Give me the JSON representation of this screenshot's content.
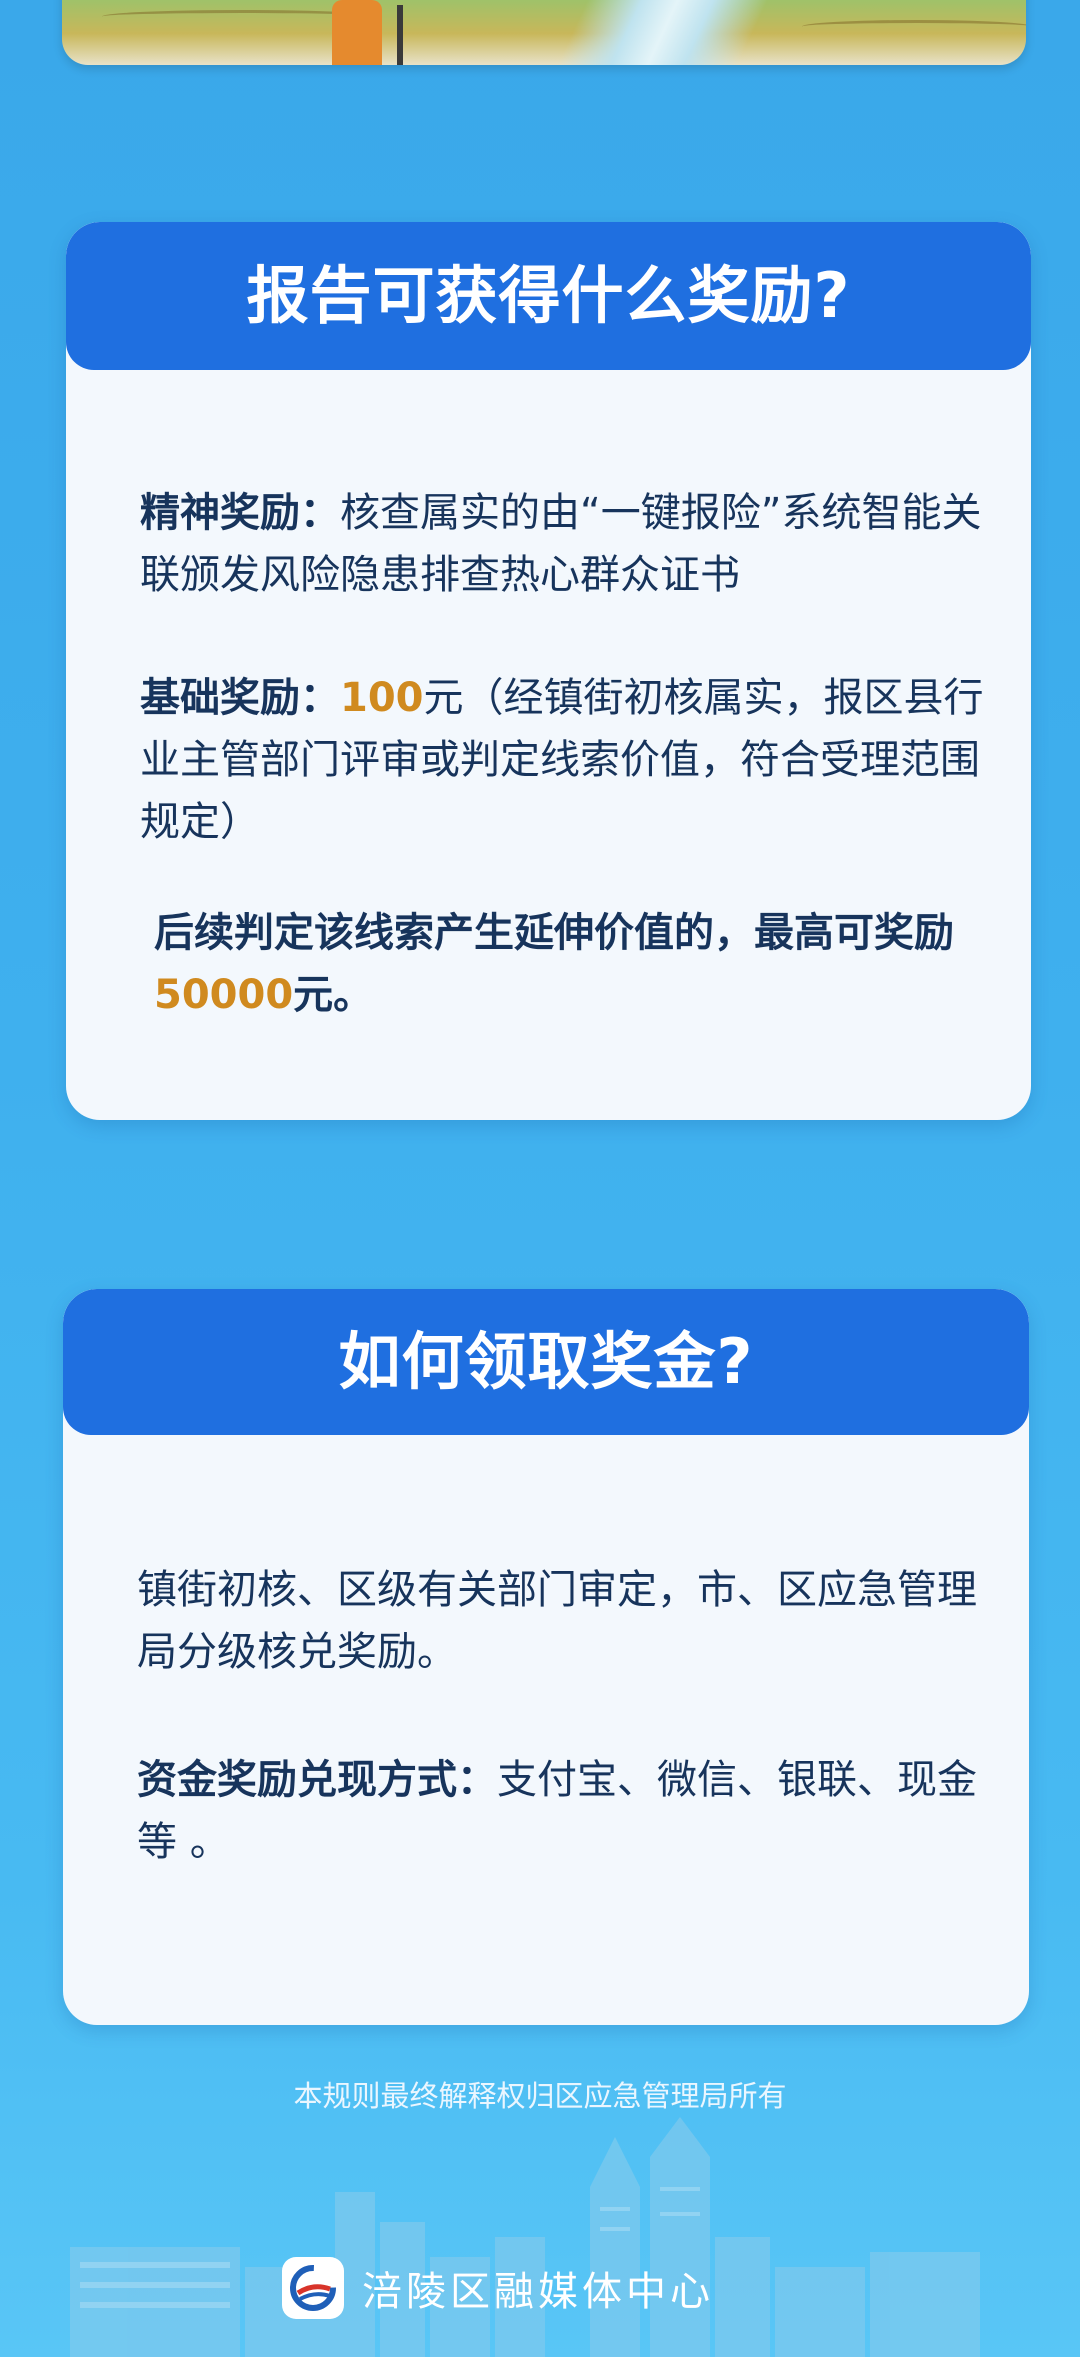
{
  "card_rewards": {
    "title": "报告可获得什么奖励?",
    "spiritual_label": "精神奖励：",
    "spiritual_text": "核查属实的由“一键报险”系统智能关联颁发风险隐患排查热心群众证书",
    "basic_label": "基础奖励：",
    "basic_amount": "100",
    "basic_text": "元（经镇街初核属实，报区县行业主管部门评审或判定线索价值，符合受理范围规定）",
    "extended_prefix": "后续判定该线索产生延伸价值的，最高可奖励",
    "extended_amount": "50000",
    "extended_suffix": "元。"
  },
  "card_claim": {
    "title": "如何领取奖金?",
    "process_text": "镇街初核、区级有关部门审定，市、区应急管理局分级核兑奖励。",
    "method_label": "资金奖励兑现方式：",
    "method_text": "支付宝、微信、银联、现金等 。"
  },
  "footer": {
    "note": "本规则最终解释权归区应急管理局所有",
    "brand_name": "涪陵区融媒体中心",
    "brand_logo_icon": "fuling-media-logo-icon"
  },
  "colors": {
    "background": "#3fb0ee",
    "header_blue": "#1f6fe0",
    "card_bg": "#f3f8fd",
    "text_dark": "#17345c",
    "highlight_amount": "#d08a1f"
  }
}
